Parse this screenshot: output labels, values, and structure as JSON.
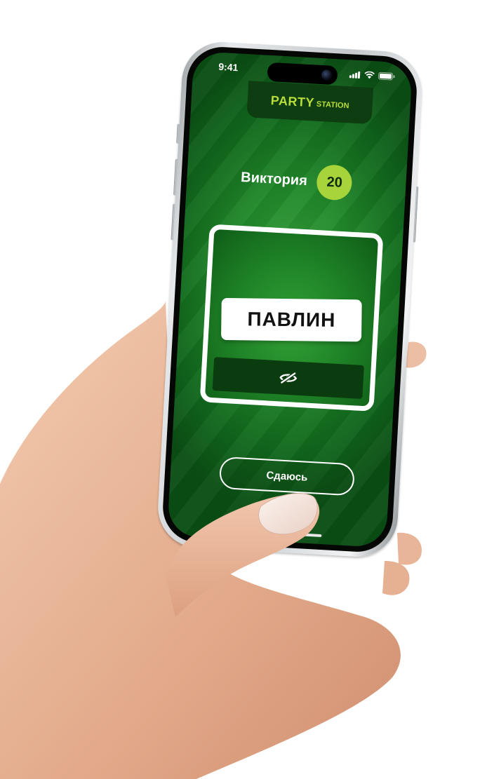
{
  "status_bar": {
    "time": "9:41"
  },
  "brand": {
    "main": "PARTY",
    "sub": "STATION"
  },
  "player": {
    "name": "Виктория",
    "score": "20"
  },
  "card": {
    "word": "ПАВЛИН",
    "hide_icon": "eye-slash-icon"
  },
  "actions": {
    "give_up_label": "Сдаюсь"
  },
  "colors": {
    "screen_green": "#228a2b",
    "brand_tab": "#0d3d10",
    "brand_text": "#b9dd3b",
    "score_badge": "#a6d43a",
    "hide_button": "#0b3c0f"
  }
}
